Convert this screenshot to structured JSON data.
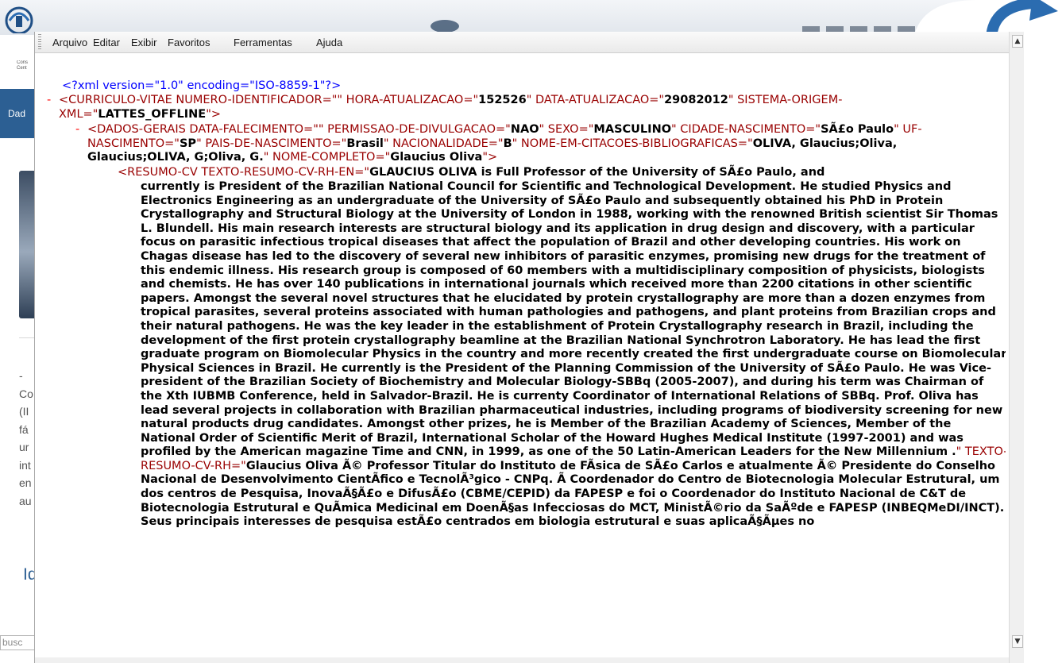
{
  "background_page": {
    "logo_sub": "Cons\nCent",
    "tab_label": "Dad",
    "side_text": [
      "-",
      "Co",
      "(II",
      "fá",
      "ur",
      "int",
      "en",
      "au"
    ],
    "section_heading": "Id",
    "search_value": "busc"
  },
  "window": {
    "menu": [
      "Arquivo",
      "Editar",
      "Exibir",
      "Favoritos",
      "Ferramentas",
      "Ajuda"
    ]
  },
  "xml": {
    "decl": "<?xml version=\"1.0\" encoding=\"ISO-8859-1\"?>",
    "minus": "-",
    "cv": {
      "open": "<CURRICULO-VITAE NUMERO-IDENTIFICADOR=\"\" HORA-ATUALIZACAO=\"",
      "hora": "152526",
      "mid1": "\" DATA-ATUALIZACAO=\"",
      "data": "29082012",
      "mid2": "\" SISTEMA-ORIGEM-XML=\"",
      "sistema": "LATTES_OFFLINE",
      "close": "\">"
    },
    "dados": {
      "a1": "<DADOS-GERAIS DATA-FALECIMENTO=\"\" PERMISSAO-DE-DIVULGACAO=\"",
      "v1": "NAO",
      "a2": "\" SEXO=\"",
      "v2": "MASCULINO",
      "a3": "\" CIDADE-NASCIMENTO=\"",
      "v3": "SÃ£o Paulo",
      "a4": "\" UF-NASCIMENTO=\"",
      "v4": "SP",
      "a5": "\" PAIS-DE-NASCIMENTO=\"",
      "v5": "Brasil",
      "a6": "\" NACIONALIDADE=\"",
      "v6": "B",
      "a7": "\" NOME-EM-CITACOES-BIBLIOGRAFICAS=\"",
      "v7": "OLIVA, Glaucius;Oliva, Glaucius;OLIVA, G;Oliva, G.",
      "a8": "\" NOME-COMPLETO=\"",
      "v8": "Glaucius Oliva",
      "close": "\">"
    },
    "resumo": {
      "open": "<RESUMO-CV TEXTO-RESUMO-CV-RH-EN=\"",
      "en_first": "GLAUCIUS OLIVA is Full Professor of the University of SÃ£o Paulo, and",
      "en_rest": "currently is President of the Brazilian National Council for Scientific and Technological Development. He studied Physics and Electronics Engineering as an undergraduate of the University of SÃ£o Paulo and subsequently obtained his PhD in Protein Crystallography and Structural Biology at the University of London in 1988, working with the renowned British scientist Sir Thomas L. Blundell. His main research interests are structural biology and its application in drug design and discovery, with a particular focus on parasitic infectious tropical diseases that affect the population of Brazil and other developing countries. His work on Chagas disease has led to the discovery of several new inhibitors of parasitic enzymes, promising new drugs for the treatment of this endemic illness. His research group is composed of 60 members with a multidisciplinary composition of physicists, biologists and chemists. He has over 140 publications in international journals which received more than 2200 citations in other scientific papers. Amongst the several novel structures that he elucidated by protein crystallography are more than a dozen enzymes from tropical parasites, several proteins associated with human pathologies and pathogens, and plant proteins from Brazilian crops and their natural pathogens. He was the key leader in the establishment of Protein Crystallography research in Brazil, including the development of the first protein crystallography beamline at the Brazilian National Synchrotron Laboratory. He has lead the first graduate program on Biomolecular Physics in the country and more recently created the first undergraduate course on Biomolecular Physical Sciences in Brazil. He currently is the President of the Planning Commission of the University of SÃ£o Paulo. He was Vice-president of the Brazilian Society of Biochemistry and Molecular Biology-SBBq (2005-2007), and during his term was Chairman of the Xth IUBMB Conference, held in Salvador-Brazil. He is currenty Coordinator of International Relations of SBBq. Prof. Oliva has lead several projects in collaboration with Brazilian pharmaceutical industries, including programs of biodiversity screening for new natural products drug candidates. Amongst other prizes, he is Member of the Brazilian Academy of Sciences, Member of the National Order of Scientific Merit of Brazil, International Scholar of the Howard Hughes Medical Institute (1997-2001) and was profiled by the American magazine Time and CNN, in 1999, as one of the 50 Latin-American Leaders for the New Millennium .",
      "attr2": "\" TEXTO-RESUMO-CV-RH=\"",
      "pt": "Glaucius Oliva Ã© Professor Titular do Instituto de FÃsica de SÃ£o Carlos e atualmente Ã© Presidente do Conselho Nacional de Desenvolvimento CientÃfico e TecnolÃ³gico - CNPq. Ã Coordenador do Centro de Biotecnologia Molecular Estrutural, um dos centros de Pesquisa, InovaÃ§Ã£o e DifusÃ£o (CBME/CEPID) da FAPESP e foi o Coordenador do Instituto Nacional de C&T de Biotecnologia Estrutural e QuÃmica Medicinal em DoenÃ§as Infecciosas do MCT, MinistÃ©rio da SaÃºde e FAPESP (INBEQMeDI/INCT). Seus principais interesses de pesquisa estÃ£o centrados em biologia estrutural e suas aplicaÃ§Ãµes no"
    }
  }
}
